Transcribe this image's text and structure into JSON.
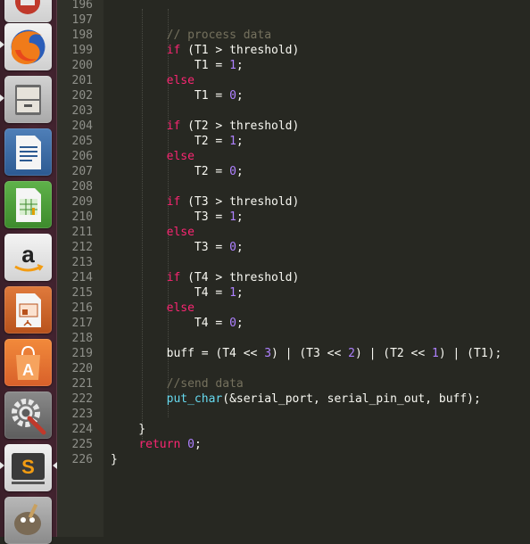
{
  "launcher": {
    "items": [
      {
        "name": "system-app-icon"
      },
      {
        "name": "firefox-icon"
      },
      {
        "name": "files-icon"
      },
      {
        "name": "libreoffice-writer-icon"
      },
      {
        "name": "libreoffice-calc-icon"
      },
      {
        "name": "amazon-icon"
      },
      {
        "name": "libreoffice-impress-icon"
      },
      {
        "name": "ubuntu-software-icon"
      },
      {
        "name": "system-settings-icon"
      },
      {
        "name": "sublime-text-icon"
      },
      {
        "name": "gimp-icon"
      }
    ]
  },
  "editor": {
    "lines": [
      {
        "n": "196",
        "tokens": [
          {
            "t": "",
            "c": ""
          }
        ]
      },
      {
        "n": "197",
        "tokens": [
          {
            "t": "",
            "c": ""
          }
        ]
      },
      {
        "n": "198",
        "tokens": [
          {
            "t": "        ",
            "c": ""
          },
          {
            "t": "// process data",
            "c": "cm"
          }
        ]
      },
      {
        "n": "199",
        "tokens": [
          {
            "t": "        ",
            "c": ""
          },
          {
            "t": "if",
            "c": "kw"
          },
          {
            "t": " (T1 > threshold)",
            "c": ""
          }
        ]
      },
      {
        "n": "200",
        "tokens": [
          {
            "t": "            T1 = ",
            "c": ""
          },
          {
            "t": "1",
            "c": "num"
          },
          {
            "t": ";",
            "c": ""
          }
        ]
      },
      {
        "n": "201",
        "tokens": [
          {
            "t": "        ",
            "c": ""
          },
          {
            "t": "else",
            "c": "kw"
          }
        ]
      },
      {
        "n": "202",
        "tokens": [
          {
            "t": "            T1 = ",
            "c": ""
          },
          {
            "t": "0",
            "c": "num"
          },
          {
            "t": ";",
            "c": ""
          }
        ]
      },
      {
        "n": "203",
        "tokens": [
          {
            "t": "",
            "c": ""
          }
        ]
      },
      {
        "n": "204",
        "tokens": [
          {
            "t": "        ",
            "c": ""
          },
          {
            "t": "if",
            "c": "kw"
          },
          {
            "t": " (T2 > threshold)",
            "c": ""
          }
        ]
      },
      {
        "n": "205",
        "tokens": [
          {
            "t": "            T2 = ",
            "c": ""
          },
          {
            "t": "1",
            "c": "num"
          },
          {
            "t": ";",
            "c": ""
          }
        ]
      },
      {
        "n": "206",
        "tokens": [
          {
            "t": "        ",
            "c": ""
          },
          {
            "t": "else",
            "c": "kw"
          }
        ]
      },
      {
        "n": "207",
        "tokens": [
          {
            "t": "            T2 = ",
            "c": ""
          },
          {
            "t": "0",
            "c": "num"
          },
          {
            "t": ";",
            "c": ""
          }
        ]
      },
      {
        "n": "208",
        "tokens": [
          {
            "t": "",
            "c": ""
          }
        ]
      },
      {
        "n": "209",
        "tokens": [
          {
            "t": "        ",
            "c": ""
          },
          {
            "t": "if",
            "c": "kw"
          },
          {
            "t": " (T3 > threshold)",
            "c": ""
          }
        ]
      },
      {
        "n": "210",
        "tokens": [
          {
            "t": "            T3 = ",
            "c": ""
          },
          {
            "t": "1",
            "c": "num"
          },
          {
            "t": ";",
            "c": ""
          }
        ]
      },
      {
        "n": "211",
        "tokens": [
          {
            "t": "        ",
            "c": ""
          },
          {
            "t": "else",
            "c": "kw"
          }
        ]
      },
      {
        "n": "212",
        "tokens": [
          {
            "t": "            T3 = ",
            "c": ""
          },
          {
            "t": "0",
            "c": "num"
          },
          {
            "t": ";",
            "c": ""
          }
        ]
      },
      {
        "n": "213",
        "tokens": [
          {
            "t": "",
            "c": ""
          }
        ]
      },
      {
        "n": "214",
        "tokens": [
          {
            "t": "        ",
            "c": ""
          },
          {
            "t": "if",
            "c": "kw"
          },
          {
            "t": " (T4 > threshold)",
            "c": ""
          }
        ]
      },
      {
        "n": "215",
        "tokens": [
          {
            "t": "            T4 = ",
            "c": ""
          },
          {
            "t": "1",
            "c": "num"
          },
          {
            "t": ";",
            "c": ""
          }
        ]
      },
      {
        "n": "216",
        "tokens": [
          {
            "t": "        ",
            "c": ""
          },
          {
            "t": "else",
            "c": "kw"
          }
        ]
      },
      {
        "n": "217",
        "tokens": [
          {
            "t": "            T4 = ",
            "c": ""
          },
          {
            "t": "0",
            "c": "num"
          },
          {
            "t": ";",
            "c": ""
          }
        ]
      },
      {
        "n": "218",
        "tokens": [
          {
            "t": "",
            "c": ""
          }
        ]
      },
      {
        "n": "219",
        "tokens": [
          {
            "t": "        buff = (T4 << ",
            "c": ""
          },
          {
            "t": "3",
            "c": "num"
          },
          {
            "t": ") | (T3 << ",
            "c": ""
          },
          {
            "t": "2",
            "c": "num"
          },
          {
            "t": ") | (T2 << ",
            "c": ""
          },
          {
            "t": "1",
            "c": "num"
          },
          {
            "t": ") | (T1);",
            "c": ""
          }
        ]
      },
      {
        "n": "220",
        "tokens": [
          {
            "t": "",
            "c": ""
          }
        ]
      },
      {
        "n": "221",
        "tokens": [
          {
            "t": "        ",
            "c": ""
          },
          {
            "t": "//send data",
            "c": "cm"
          }
        ]
      },
      {
        "n": "222",
        "tokens": [
          {
            "t": "        ",
            "c": ""
          },
          {
            "t": "put_char",
            "c": "fn"
          },
          {
            "t": "(&serial_port, serial_pin_out, buff);",
            "c": ""
          }
        ]
      },
      {
        "n": "223",
        "tokens": [
          {
            "t": "",
            "c": ""
          }
        ]
      },
      {
        "n": "224",
        "tokens": [
          {
            "t": "    }",
            "c": ""
          }
        ]
      },
      {
        "n": "225",
        "tokens": [
          {
            "t": "    ",
            "c": ""
          },
          {
            "t": "return",
            "c": "kw"
          },
          {
            "t": " ",
            "c": ""
          },
          {
            "t": "0",
            "c": "num"
          },
          {
            "t": ";",
            "c": ""
          }
        ]
      },
      {
        "n": "226",
        "tokens": [
          {
            "t": "}",
            "c": ""
          }
        ]
      }
    ]
  },
  "colors": {
    "background": "#272822",
    "gutter": "#2f3029",
    "keyword": "#f92672",
    "number": "#ae81ff",
    "comment": "#75715e",
    "function": "#66d9ef",
    "text": "#f8f8f2",
    "launcher": "#4a2633"
  }
}
